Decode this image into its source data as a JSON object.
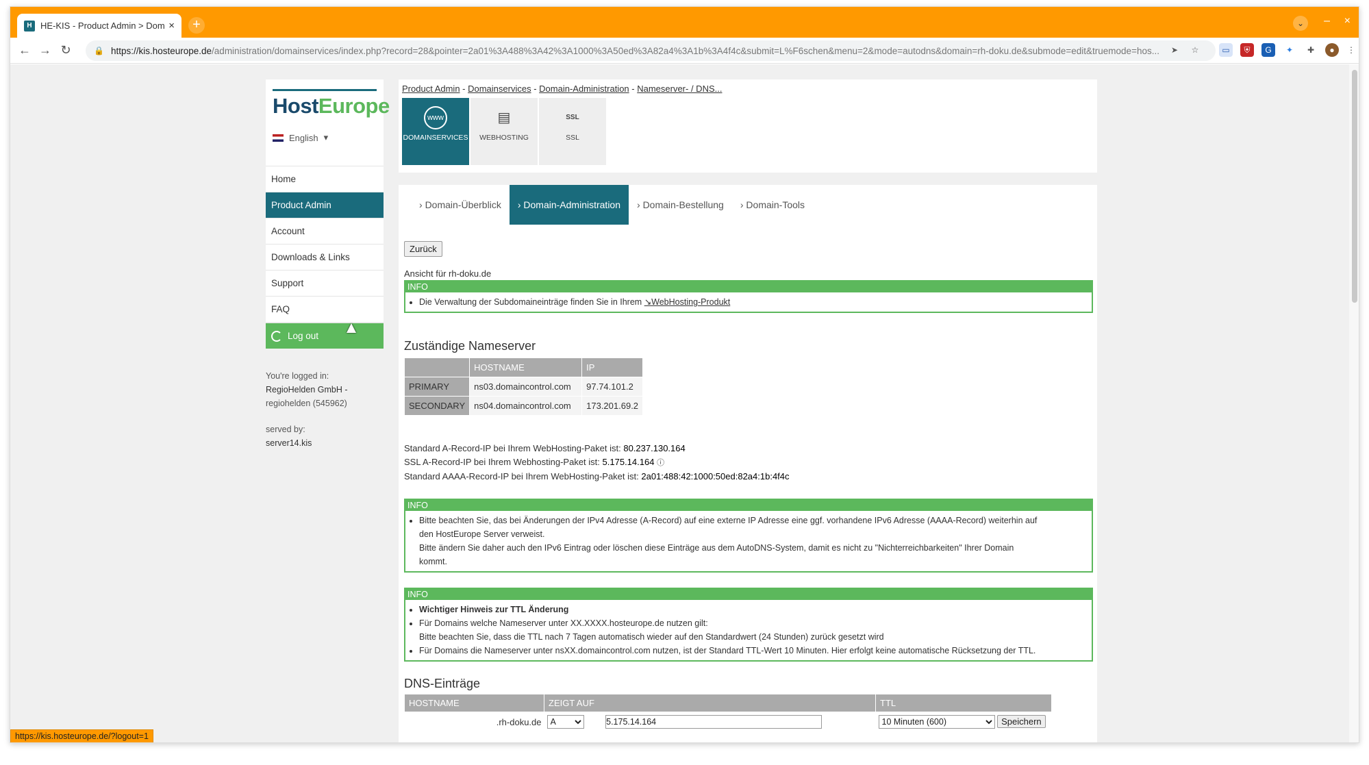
{
  "browser": {
    "tab_title": "HE-KIS - Product Admin > Dom",
    "tab_favicon": "H",
    "url_host": "https://kis.hosteurope.de",
    "url_rest": "/administration/domainservices/index.php?record=28&pointer=2a01%3A488%3A42%3A1000%3A50ed%3A82a4%3A1b%3A4f4c&submit=L%F6schen&menu=2&mode=autodns&domain=rh-doku.de&submode=edit&truemode=hos...",
    "status_url": "https://kis.hosteurope.de/?logout=1"
  },
  "sidebar": {
    "logo_a": "Host",
    "logo_b": "Europe",
    "language": "English",
    "items": [
      {
        "label": "Home"
      },
      {
        "label": "Product Admin"
      },
      {
        "label": "Account"
      },
      {
        "label": "Downloads & Links"
      },
      {
        "label": "Support"
      },
      {
        "label": "FAQ"
      }
    ],
    "logout": "Log out",
    "logged_in_label": "You're logged in:",
    "company": "RegioHelden GmbH -",
    "user": "regiohelden (545962)",
    "served_by_label": "served by:",
    "server": "server14.kis"
  },
  "breadcrumb": [
    "Product Admin",
    "Domainservices",
    "Domain-Administration",
    "Nameserver- / DNS..."
  ],
  "services": [
    {
      "label": "DOMAINSERVICES",
      "icon": "www-globe-icon",
      "glyph": "www"
    },
    {
      "label": "WEBHOSTING",
      "icon": "server-icon",
      "glyph": "▤"
    },
    {
      "label": "SSL",
      "icon": "ssl-shield-icon",
      "glyph": "SSL"
    }
  ],
  "subtabs": [
    "Domain-Überblick",
    "Domain-Administration",
    "Domain-Bestellung",
    "Domain-Tools"
  ],
  "main": {
    "back_button": "Zurück",
    "view_for": "Ansicht für rh-doku.de",
    "info_label": "INFO",
    "info1_text": "Die Verwaltung der Subdomaineinträge finden Sie in Ihrem",
    "info1_link": "↘WebHosting-Produkt",
    "ns_heading": "Zuständige Nameserver",
    "ns_headers": [
      "",
      "HOSTNAME",
      "IP"
    ],
    "ns_rows": [
      {
        "role": "PRIMARY",
        "host": "ns03.domaincontrol.com",
        "ip": "97.74.101.2"
      },
      {
        "role": "SECONDARY",
        "host": "ns04.domaincontrol.com",
        "ip": "173.201.69.2"
      }
    ],
    "std_a_label": "Standard A-Record-IP bei Ihrem WebHosting-Paket ist:",
    "std_a_value": "80.237.130.164",
    "ssl_a_label": "SSL A-Record-IP bei Ihrem Webhosting-Paket ist:",
    "ssl_a_value": "5.175.14.164",
    "std_aaaa_label": "Standard AAAA-Record-IP bei Ihrem WebHosting-Paket ist:",
    "std_aaaa_value": "2a01:488:42:1000:50ed:82a4:1b:4f4c",
    "info2_line1": "Bitte beachten Sie, das bei Änderungen der IPv4 Adresse (A-Record) auf eine externe IP Adresse eine ggf. vorhandene IPv6 Adresse (AAAA-Record) weiterhin auf",
    "info2_line2": "den HostEurope Server verweist.",
    "info2_line3": "Bitte ändern Sie daher auch den IPv6 Eintrag oder löschen diese Einträge aus dem AutoDNS-System, damit es nicht zu \"Nichterreichbarkeiten\" Ihrer Domain",
    "info2_line4": "kommt.",
    "info3_title": "Wichtiger Hinweis zur TTL Änderung",
    "info3_line1": "Für Domains welche Nameserver unter XX.XXXX.hosteurope.de nutzen gilt:",
    "info3_line2": "Bitte beachten Sie, dass die TTL nach 7 Tagen automatisch wieder auf den Standardwert (24 Stunden) zurück gesetzt wird",
    "info3_line3": "Für Domains die Nameserver unter nsXX.domaincontrol.com nutzen, ist der Standard TTL-Wert 10 Minuten. Hier erfolgt keine automatische Rücksetzung der TTL.",
    "dns_heading": "DNS-Einträge",
    "dns_headers": [
      "HOSTNAME",
      "ZEIGT AUF",
      "TTL"
    ],
    "dns_row": {
      "host_suffix": ".rh-doku.de",
      "type": "A",
      "value": "5.175.14.164",
      "ttl": "10 Minuten (600)",
      "save": "Speichern"
    }
  }
}
